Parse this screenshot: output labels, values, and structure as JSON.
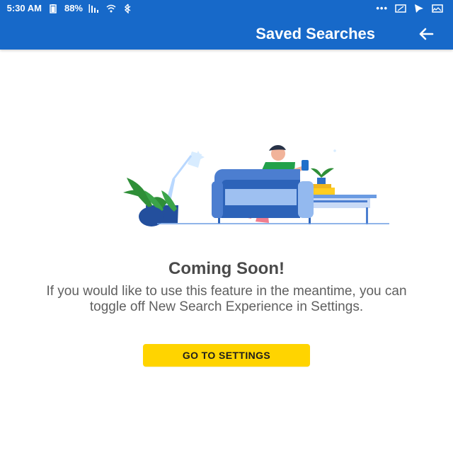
{
  "status_bar": {
    "time": "5:30 AM",
    "battery": "88%",
    "dots": "•••"
  },
  "app_bar": {
    "title": "Saved Searches",
    "back_icon": "arrow-icon"
  },
  "content": {
    "heading": "Coming Soon!",
    "message": "If you would like to use this feature in the meantime, you can toggle off New Search Experience in Settings.",
    "button_label": "GO TO SETTINGS"
  },
  "colors": {
    "app_bar": "#1769c9",
    "button": "#ffd400",
    "heading": "#4a4a4a",
    "body": "#5f5f5f",
    "sofa": "#4c7ed0",
    "plant": "#2f8f38"
  },
  "icons": [
    "arrow-icon",
    "bluetooth-icon",
    "wifi-icon",
    "signal-icon",
    "battery-icon",
    "mute-icon",
    "notification-icon",
    "image-icon"
  ]
}
